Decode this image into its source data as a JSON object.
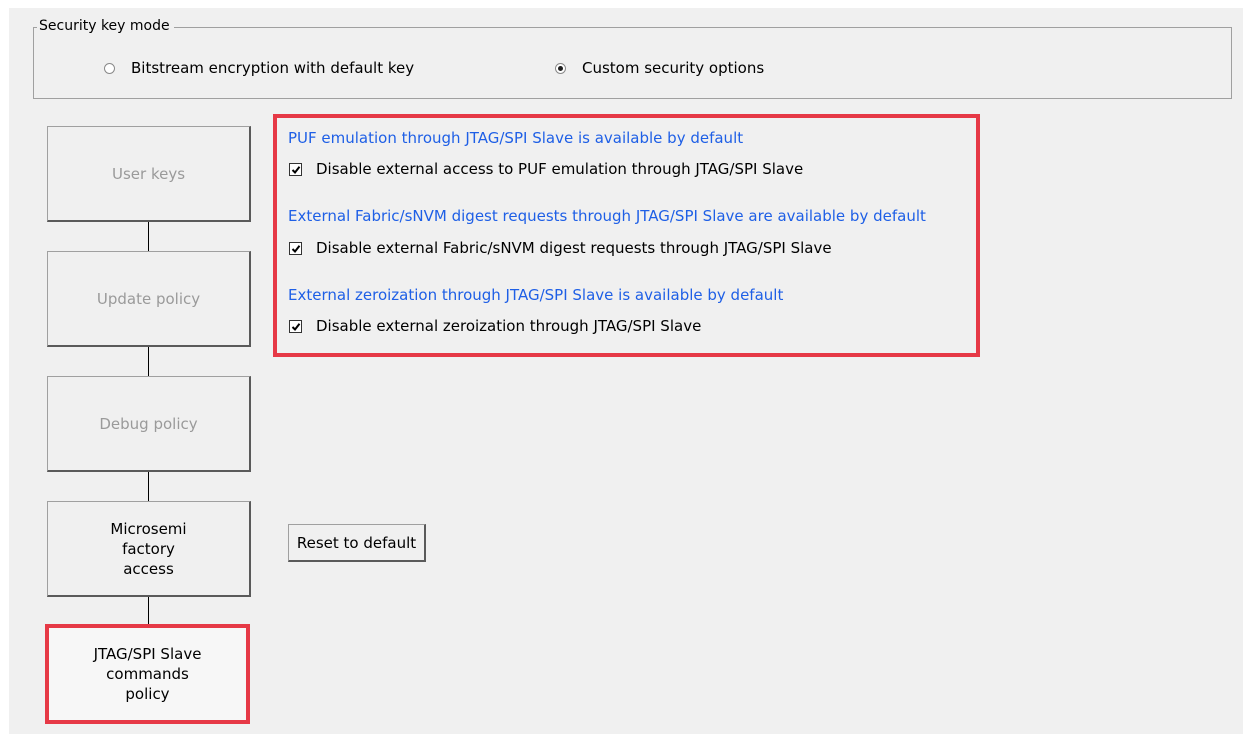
{
  "security_key_mode": {
    "title": "Security key mode",
    "options": [
      {
        "label": "Bitstream encryption with default key",
        "selected": false
      },
      {
        "label": "Custom security options",
        "selected": true
      }
    ]
  },
  "steps": [
    {
      "label": "User keys",
      "state": "disabled"
    },
    {
      "label": "Update policy",
      "state": "disabled"
    },
    {
      "label": "Debug policy",
      "state": "disabled"
    },
    {
      "label": "Microsemi\nfactory\naccess",
      "state": "enabled"
    },
    {
      "label": "JTAG/SPI Slave\ncommands\npolicy",
      "state": "active"
    }
  ],
  "jtag_policy": {
    "items": [
      {
        "info": "PUF emulation through JTAG/SPI Slave is available by default",
        "checkbox_label": "Disable external access to PUF emulation through JTAG/SPI Slave",
        "checked": true
      },
      {
        "info": "External Fabric/sNVM digest requests through JTAG/SPI Slave are available by default",
        "checkbox_label": "Disable external Fabric/sNVM digest requests through JTAG/SPI Slave",
        "checked": true
      },
      {
        "info": "External zeroization through JTAG/SPI Slave is available by default",
        "checkbox_label": "Disable external zeroization through JTAG/SPI Slave",
        "checked": true
      }
    ],
    "reset_button_label": "Reset to default"
  },
  "colors": {
    "info_text": "#1e5fe6",
    "highlight": "#e63946",
    "disabled_text": "#9a9a9a",
    "panel_background": "#f0f0f0"
  }
}
